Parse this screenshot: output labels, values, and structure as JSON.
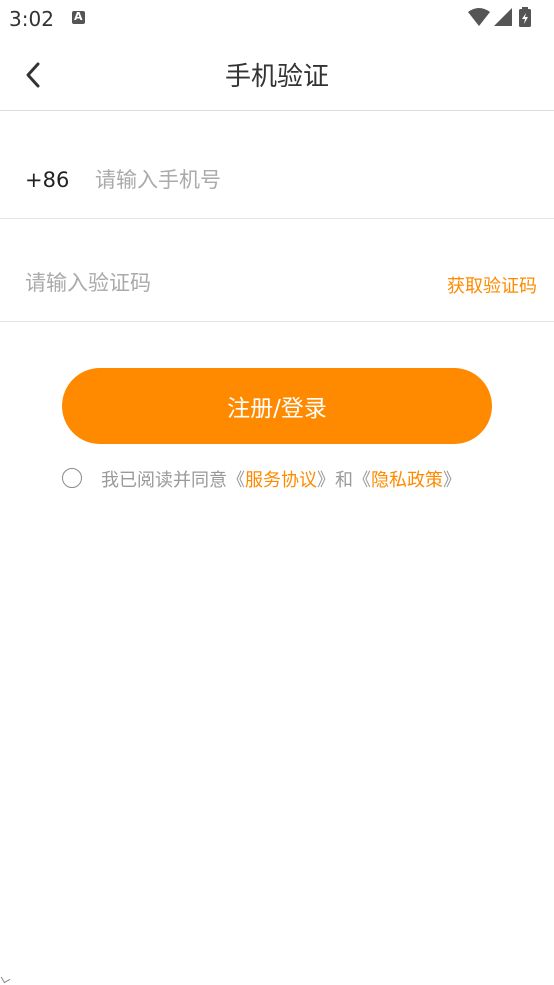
{
  "status_bar": {
    "time": "3:02"
  },
  "header": {
    "title": "手机验证"
  },
  "phone_row": {
    "country_code": "+86",
    "placeholder": "请输入手机号",
    "value": ""
  },
  "code_row": {
    "placeholder": "请输入验证码",
    "value": "",
    "get_code_label": "获取验证码"
  },
  "submit": {
    "label": "注册/登录"
  },
  "agreement": {
    "checked": false,
    "prefix": "我已阅读并同意",
    "open1": "《",
    "link1": "服务协议",
    "close1": "》",
    "and": "和",
    "open2": "《",
    "link2": "隐私政策",
    "close2": "》"
  },
  "colors": {
    "accent": "#ff8a00",
    "placeholder": "#aaaaaa",
    "divider": "#e4e4e4"
  },
  "icons": [
    "a-notification-icon",
    "wifi-icon",
    "signal-icon",
    "battery-icon",
    "back-arrow-icon"
  ]
}
